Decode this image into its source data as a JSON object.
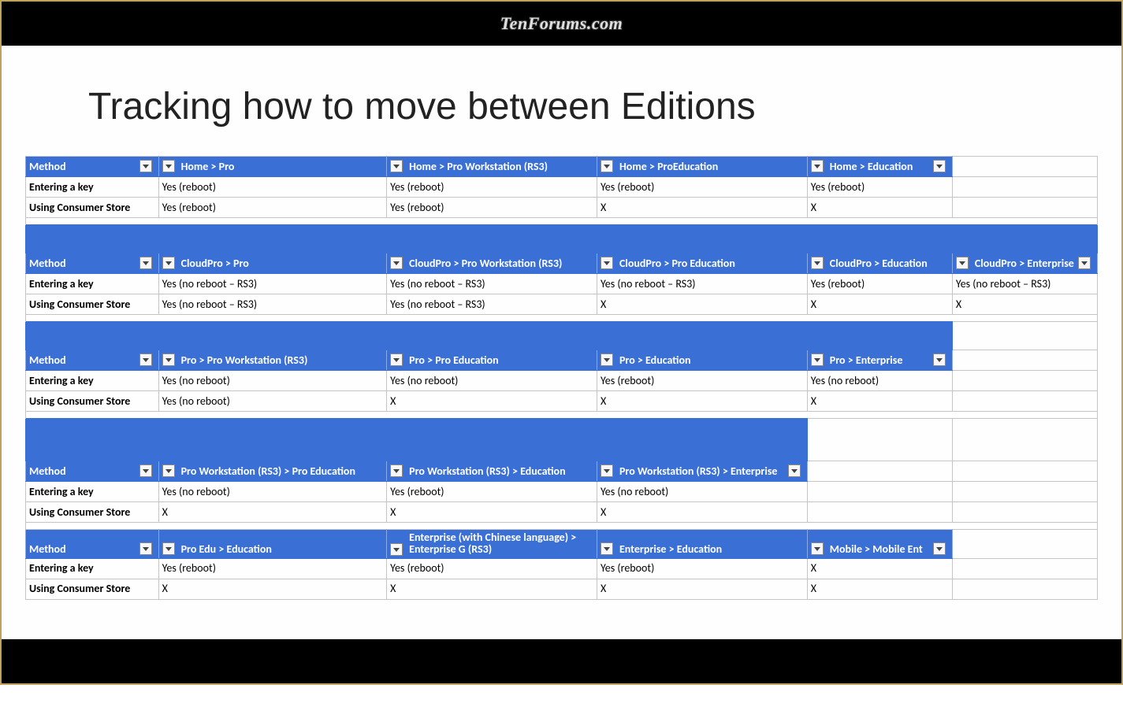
{
  "watermark": "TenForums.com",
  "title": "Tracking how to move between Editions",
  "labels": {
    "method": "Method",
    "enter_key": "Entering a key",
    "consumer_store": "Using Consumer Store"
  },
  "tables": [
    {
      "cols": [
        "Home > Pro",
        "Home > Pro Workstation (RS3)",
        "Home > ProEducation",
        "Home > Education",
        ""
      ],
      "rows": [
        [
          "Yes (reboot)",
          "Yes (reboot)",
          "Yes (reboot)",
          "Yes (reboot)",
          ""
        ],
        [
          "Yes (reboot)",
          "Yes (reboot)",
          "X",
          "X",
          ""
        ]
      ]
    },
    {
      "cols": [
        "CloudPro > Pro",
        "CloudPro > Pro Workstation (RS3)",
        "CloudPro > Pro Education",
        "CloudPro > Education",
        "CloudPro > Enterprise"
      ],
      "rows": [
        [
          "Yes (no reboot – RS3)",
          "Yes (no reboot – RS3)",
          "Yes (no reboot – RS3)",
          "Yes (reboot)",
          "Yes (no reboot – RS3)"
        ],
        [
          "Yes (no reboot – RS3)",
          "Yes (no reboot – RS3)",
          "X",
          "X",
          "X"
        ]
      ]
    },
    {
      "cols": [
        "Pro > Pro Workstation (RS3)",
        "Pro > Pro Education",
        "Pro > Education",
        "Pro > Enterprise",
        ""
      ],
      "rows": [
        [
          "Yes (no reboot)",
          "Yes (no reboot)",
          "Yes (reboot)",
          "Yes (no reboot)",
          ""
        ],
        [
          "Yes (no reboot)",
          "X",
          "X",
          "X",
          ""
        ]
      ]
    },
    {
      "cols": [
        "Pro Workstation (RS3) > Pro Education",
        "Pro Workstation (RS3) > Education",
        "Pro Workstation (RS3) > Enterprise",
        "",
        ""
      ],
      "rows": [
        [
          "Yes (no reboot)",
          "Yes (reboot)",
          "Yes (no reboot)",
          "",
          ""
        ],
        [
          "X",
          "X",
          "X",
          "",
          ""
        ]
      ]
    },
    {
      "cols": [
        "Pro Edu > Education",
        "Enterprise (with Chinese language) > Enterprise G (RS3)",
        "Enterprise > Education",
        "Mobile > Mobile Ent",
        ""
      ],
      "rows": [
        [
          "Yes (reboot)",
          "Yes (reboot)",
          "Yes (reboot)",
          "X",
          ""
        ],
        [
          "X",
          "X",
          "X",
          "X",
          ""
        ]
      ]
    }
  ]
}
